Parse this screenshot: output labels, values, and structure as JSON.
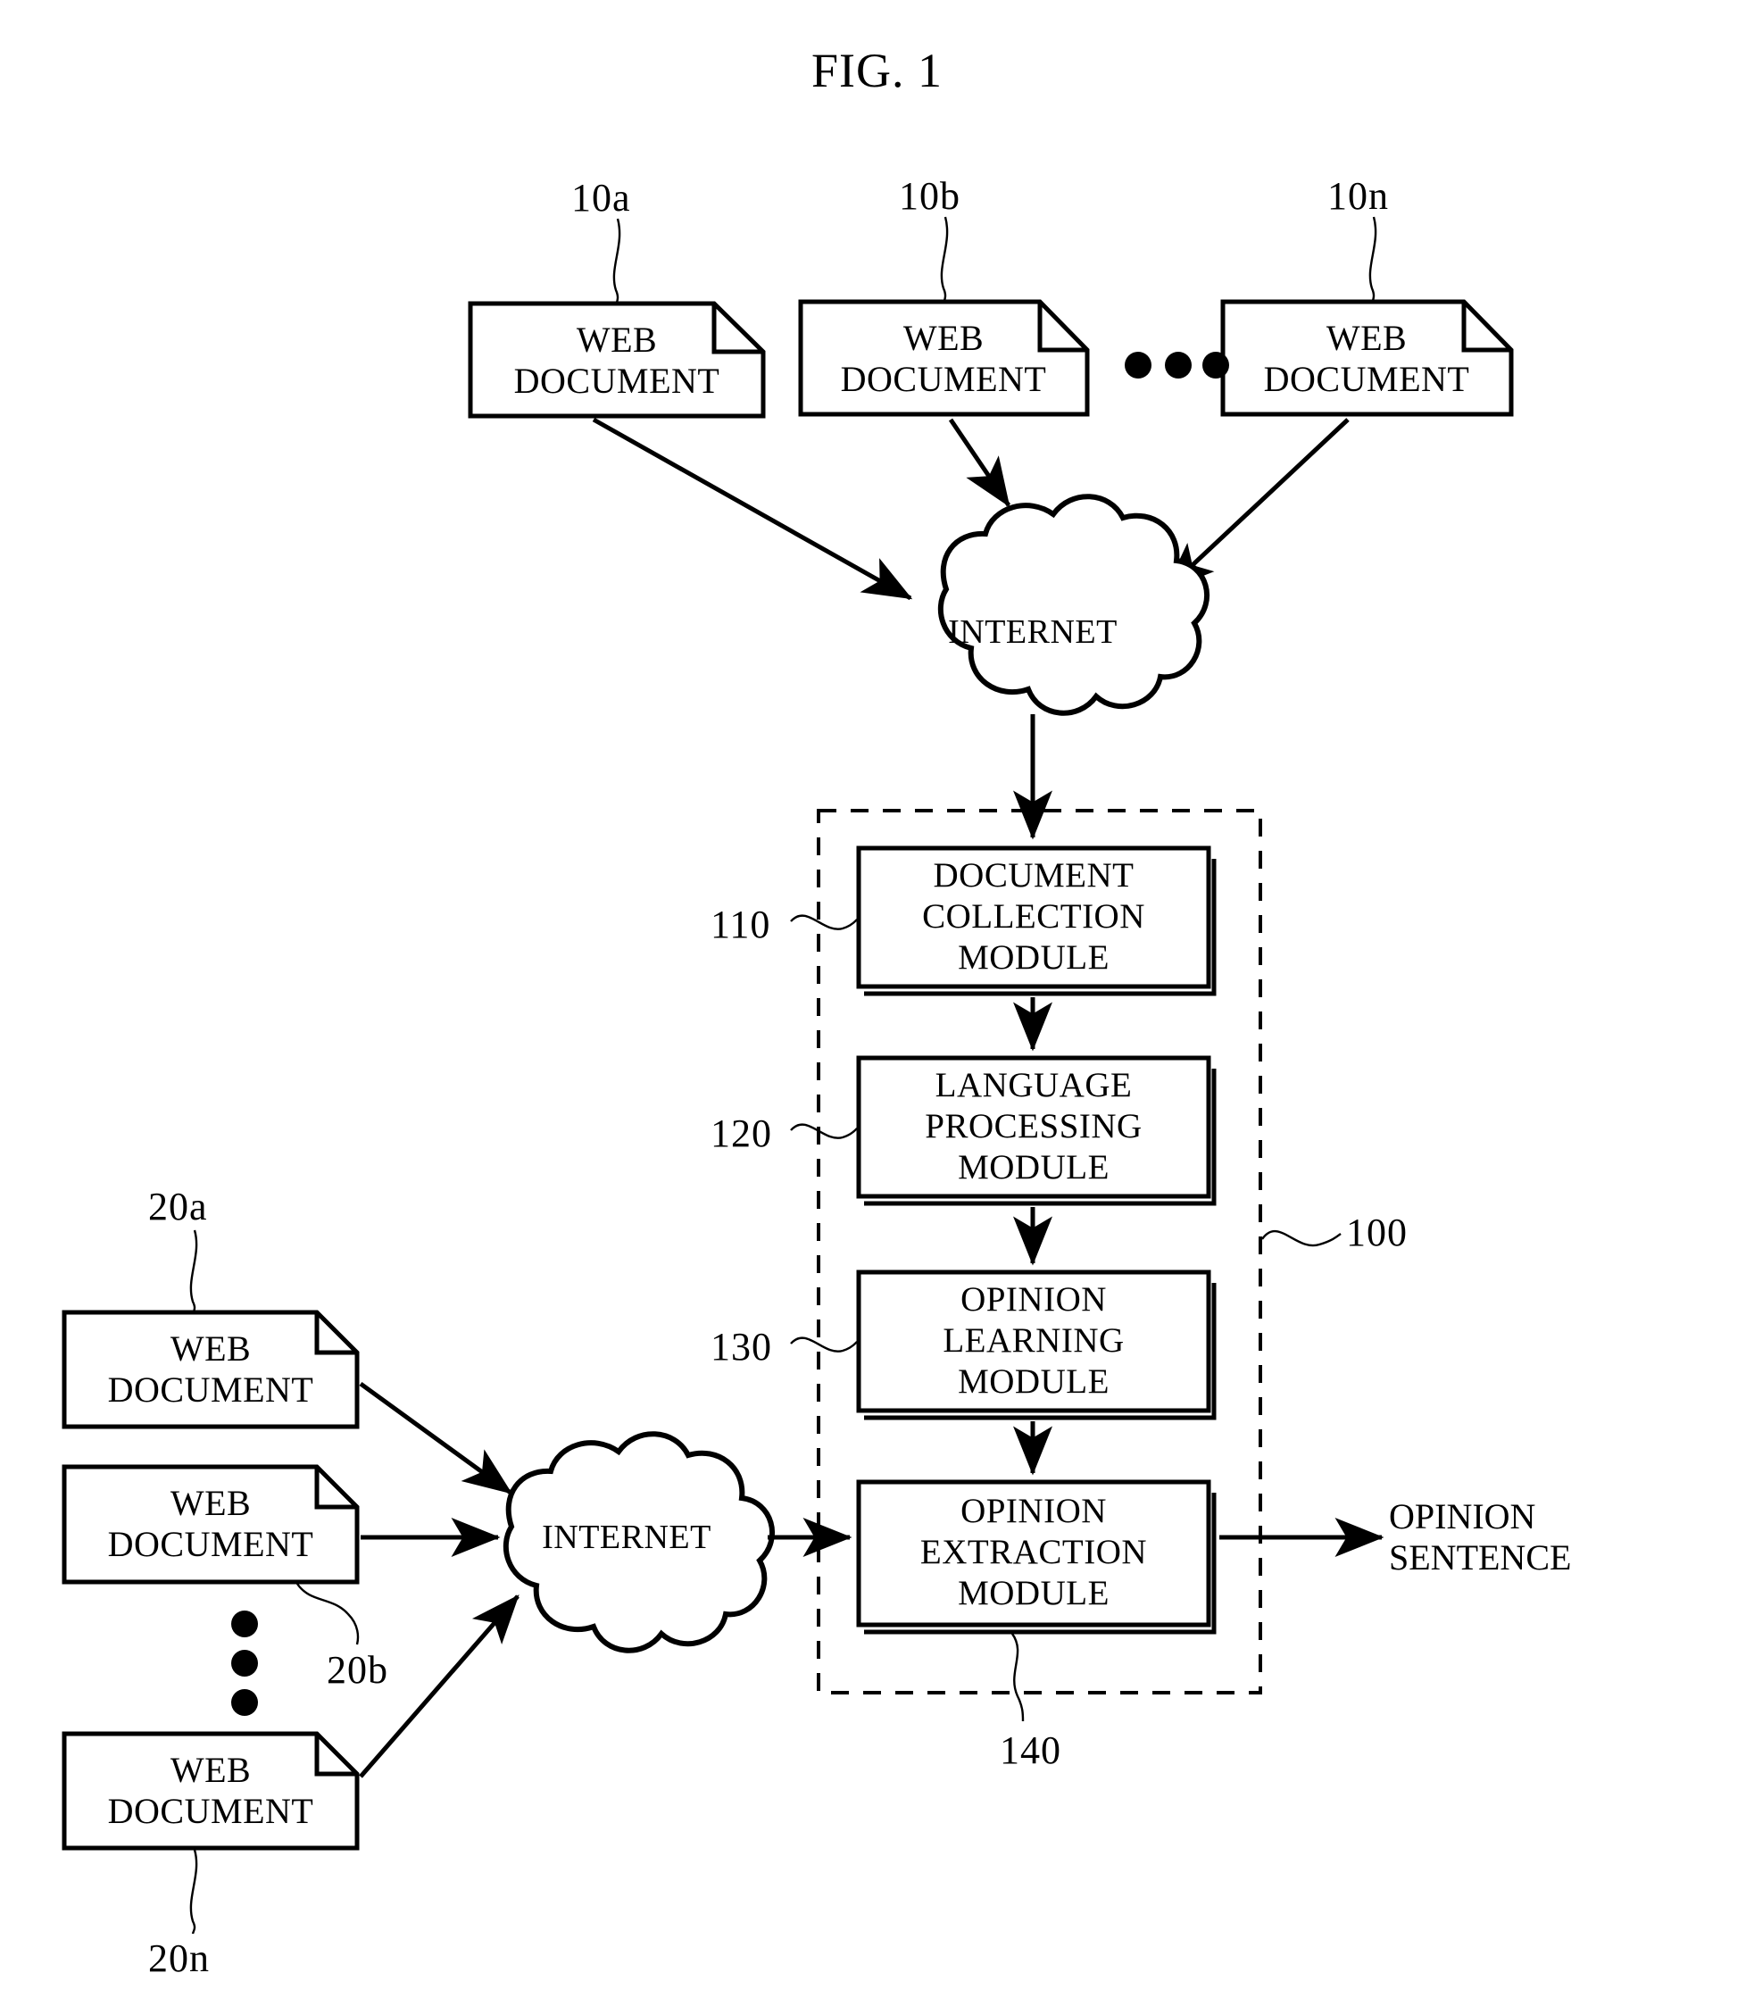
{
  "figure": {
    "title": "FIG. 1"
  },
  "top_sources": {
    "documents": [
      {
        "label": "WEB\nDOCUMENT",
        "ref": "10a"
      },
      {
        "label": "WEB\nDOCUMENT",
        "ref": "10b"
      },
      {
        "label": "WEB\nDOCUMENT",
        "ref": "10n"
      }
    ],
    "ellipsis": "•  •  •"
  },
  "bottom_sources": {
    "documents": [
      {
        "label": "WEB\nDOCUMENT",
        "ref": "20a"
      },
      {
        "label": "WEB\nDOCUMENT",
        "ref": "20b"
      },
      {
        "label": "WEB\nDOCUMENT",
        "ref": "20n"
      }
    ]
  },
  "networks": {
    "top_cloud": "INTERNET",
    "bottom_cloud": "INTERNET"
  },
  "system": {
    "ref": "100",
    "modules": [
      {
        "label": "DOCUMENT\nCOLLECTION\nMODULE",
        "ref": "110"
      },
      {
        "label": "LANGUAGE\nPROCESSING\nMODULE",
        "ref": "120"
      },
      {
        "label": "OPINION\nLEARNING\nMODULE",
        "ref": "130"
      },
      {
        "label": "OPINION\nEXTRACTION\nMODULE",
        "ref": "140"
      }
    ]
  },
  "output": {
    "label": "OPINION\nSENTENCE"
  },
  "colors": {
    "stroke": "#000000",
    "background": "#ffffff"
  }
}
